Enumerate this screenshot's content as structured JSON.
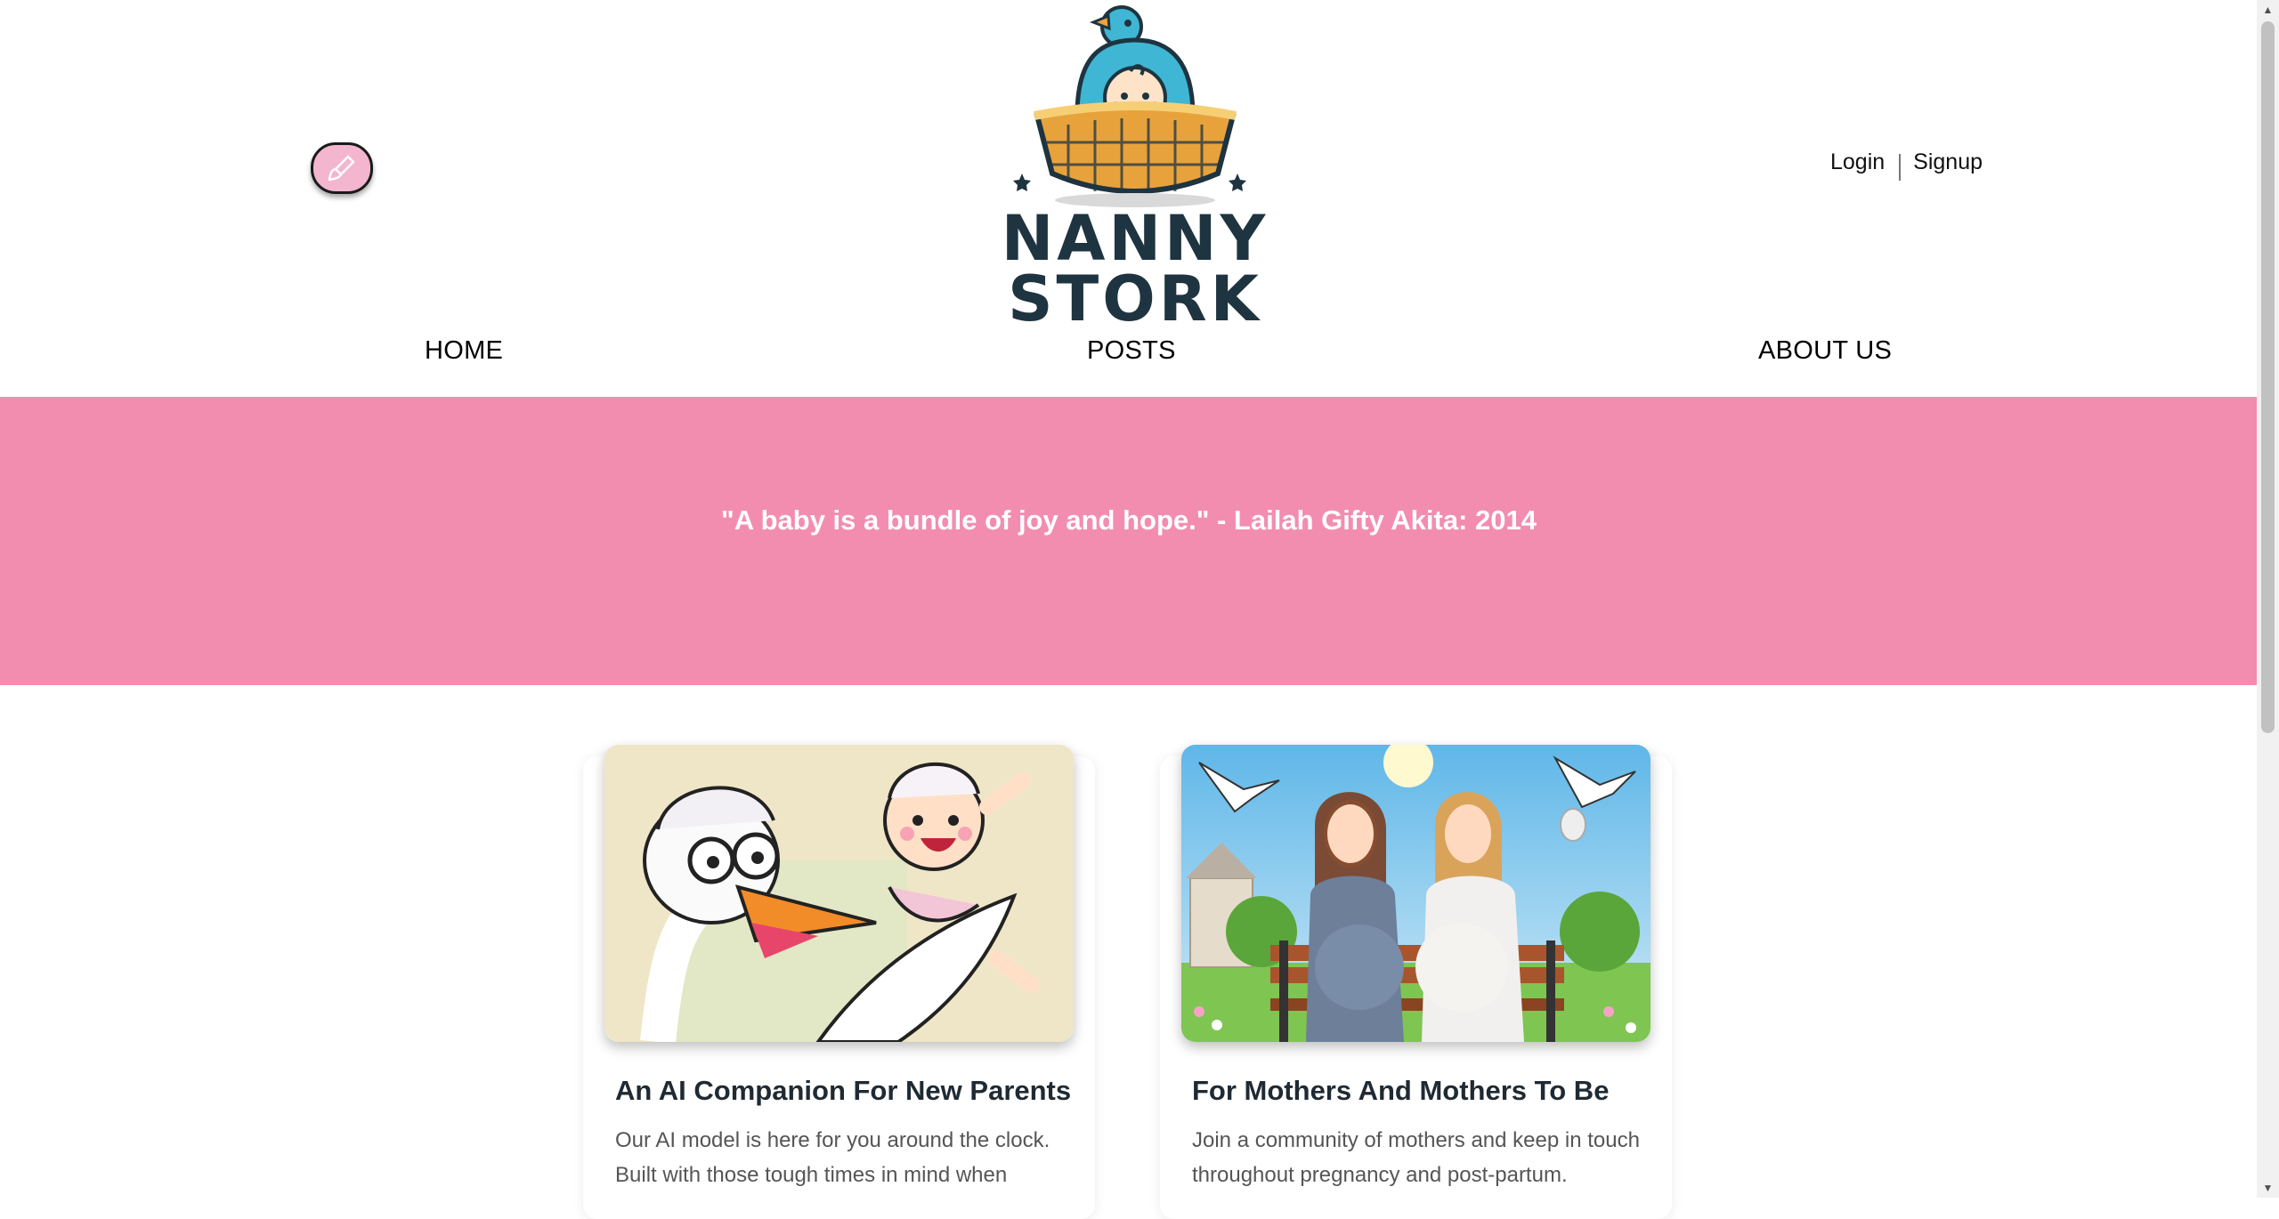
{
  "header": {
    "theme_toggle_icon": "brush-icon",
    "logo": {
      "line1": "NANNY",
      "line2": "STORK"
    },
    "auth": {
      "login": "Login",
      "signup": "Signup"
    },
    "nav": {
      "home": "HOME",
      "posts": "POSTS",
      "about": "ABOUT US"
    }
  },
  "banner": {
    "quote": "\"A baby is a bundle of joy and hope.\" - Lailah Gifty Akita: 2014",
    "background": "#f38db0"
  },
  "cards": [
    {
      "title": "An AI Companion For New Parents",
      "text": "Our AI model is here for you around the clock. Built with those tough times in mind when"
    },
    {
      "title": "For Mothers And Mothers To Be",
      "text": "Join a community of mothers and keep in touch throughout pregnancy and post-partum."
    }
  ],
  "colors": {
    "accent_pink": "#f38db0",
    "logo_text": "#1e3440",
    "toggle_pink": "#f4b5cf"
  }
}
